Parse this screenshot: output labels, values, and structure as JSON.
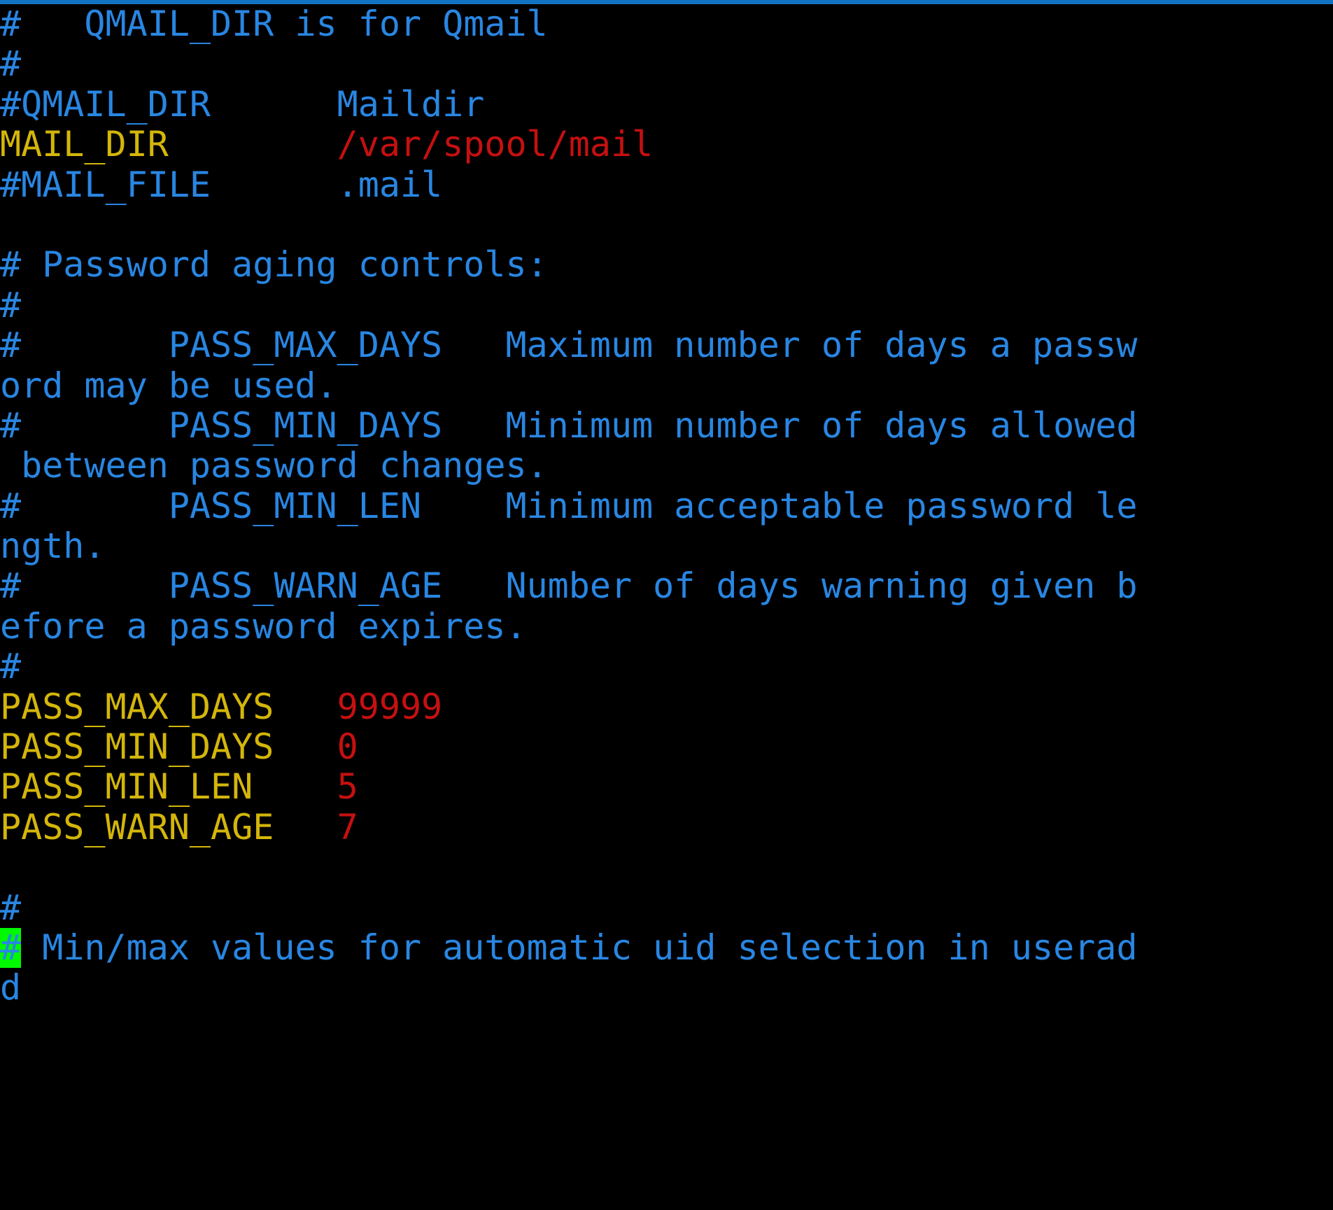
{
  "window": {
    "app": "terminal-text-editor",
    "top_accent_color": "#1273c4",
    "background_color": "#000000"
  },
  "palette": {
    "comment": "#2986e2",
    "keyword": "#d4b60a",
    "value": "#c61010",
    "cursor_bg": "#00f800",
    "cursor_fg": "#2986e2"
  },
  "editor": {
    "file_content_note": "/etc/login.defs password aging section",
    "cursor": {
      "char": "#",
      "row_index": 20,
      "column_index": 0
    },
    "lines": [
      {
        "id": "l1",
        "segments": [
          {
            "text": "#   QMAIL_DIR is for Qmail",
            "style": "comment"
          }
        ]
      },
      {
        "id": "l2",
        "segments": [
          {
            "text": "#",
            "style": "comment"
          }
        ]
      },
      {
        "id": "l3",
        "segments": [
          {
            "text": "#QMAIL_DIR      Maildir",
            "style": "comment"
          }
        ]
      },
      {
        "id": "l4",
        "segments": [
          {
            "text": "MAIL_DIR        ",
            "style": "keyword"
          },
          {
            "text": "/var/spool/mail",
            "style": "value"
          }
        ]
      },
      {
        "id": "l5",
        "segments": [
          {
            "text": "#MAIL_FILE      .mail",
            "style": "comment"
          }
        ]
      },
      {
        "id": "l6",
        "segments": [
          {
            "text": "",
            "style": "comment"
          }
        ]
      },
      {
        "id": "l7",
        "segments": [
          {
            "text": "# Password aging controls:",
            "style": "comment"
          }
        ]
      },
      {
        "id": "l8",
        "segments": [
          {
            "text": "#",
            "style": "comment"
          }
        ]
      },
      {
        "id": "l9",
        "segments": [
          {
            "text": "#       PASS_MAX_DAYS   Maximum number of days a passw",
            "style": "comment"
          }
        ]
      },
      {
        "id": "l10",
        "segments": [
          {
            "text": "ord may be used.",
            "style": "comment"
          }
        ]
      },
      {
        "id": "l11",
        "segments": [
          {
            "text": "#       PASS_MIN_DAYS   Minimum number of days allowed",
            "style": "comment"
          }
        ]
      },
      {
        "id": "l12",
        "segments": [
          {
            "text": " between password changes.",
            "style": "comment"
          }
        ]
      },
      {
        "id": "l13",
        "segments": [
          {
            "text": "#       PASS_MIN_LEN    Minimum acceptable password le",
            "style": "comment"
          }
        ]
      },
      {
        "id": "l14",
        "segments": [
          {
            "text": "ngth.",
            "style": "comment"
          }
        ]
      },
      {
        "id": "l15",
        "segments": [
          {
            "text": "#       PASS_WARN_AGE   Number of days warning given b",
            "style": "comment"
          }
        ]
      },
      {
        "id": "l16",
        "segments": [
          {
            "text": "efore a password expires.",
            "style": "comment"
          }
        ]
      },
      {
        "id": "l17",
        "segments": [
          {
            "text": "#",
            "style": "comment"
          }
        ]
      },
      {
        "id": "l18",
        "segments": [
          {
            "text": "PASS_MAX_DAYS   ",
            "style": "keyword"
          },
          {
            "text": "99999",
            "style": "value"
          }
        ]
      },
      {
        "id": "l19",
        "segments": [
          {
            "text": "PASS_MIN_DAYS   ",
            "style": "keyword"
          },
          {
            "text": "0",
            "style": "value"
          }
        ]
      },
      {
        "id": "l20",
        "segments": [
          {
            "text": "PASS_MIN_LEN    ",
            "style": "keyword"
          },
          {
            "text": "5",
            "style": "value"
          }
        ]
      },
      {
        "id": "l21",
        "segments": [
          {
            "text": "PASS_WARN_AGE   ",
            "style": "keyword"
          },
          {
            "text": "7",
            "style": "value"
          }
        ]
      },
      {
        "id": "l22",
        "segments": [
          {
            "text": "",
            "style": "comment"
          }
        ]
      },
      {
        "id": "l23",
        "segments": [
          {
            "text": "#",
            "style": "comment"
          }
        ]
      },
      {
        "id": "l24",
        "segments": [
          {
            "text": "#",
            "style": "comment",
            "cursor": true
          },
          {
            "text": " Min/max values for automatic uid selection in userad",
            "style": "comment"
          }
        ]
      },
      {
        "id": "l25",
        "segments": [
          {
            "text": "d",
            "style": "comment"
          }
        ]
      }
    ]
  }
}
